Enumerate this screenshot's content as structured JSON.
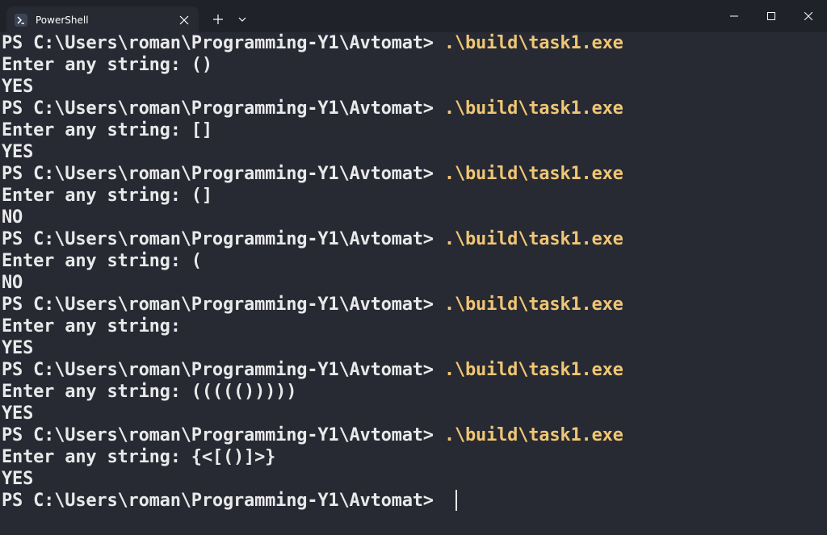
{
  "window": {
    "tab_title": "PowerShell",
    "tab_icon": "powershell-icon",
    "controls": {
      "new_tab_icon": "plus-icon",
      "dropdown_icon": "chevron-down-icon",
      "minimize_icon": "minimize-icon",
      "maximize_icon": "maximize-icon",
      "close_icon": "close-icon"
    }
  },
  "colors": {
    "background": "#272a33",
    "titlebar": "#1f2228",
    "text": "#e9e9ea",
    "command": "#f0c674"
  },
  "terminal": {
    "prompt": "PS C:\\Users\\roman\\Programming-Y1\\Avtomat> ",
    "command": ".\\build\\task1.exe",
    "entries": [
      {
        "input_line": "Enter any string: ()",
        "result": "YES"
      },
      {
        "input_line": "Enter any string: []",
        "result": "YES"
      },
      {
        "input_line": "Enter any string: (]",
        "result": "NO"
      },
      {
        "input_line": "Enter any string: (",
        "result": "NO"
      },
      {
        "input_line": "Enter any string: ",
        "result": "YES"
      },
      {
        "input_line": "Enter any string: ((((())))) ",
        "result": "YES"
      },
      {
        "input_line": "Enter any string: {<[()]>}",
        "result": "YES"
      }
    ],
    "final_prompt": "PS C:\\Users\\roman\\Programming-Y1\\Avtomat> "
  }
}
